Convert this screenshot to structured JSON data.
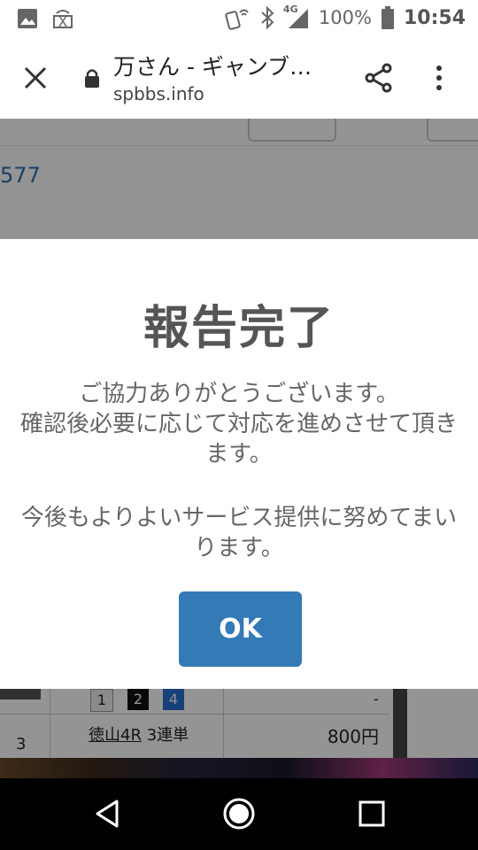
{
  "status_bar": {
    "network": "4G",
    "battery": "100%",
    "time": "10:54"
  },
  "browser": {
    "page_title": "万さん - ギャンブ…",
    "domain": "spbbs.info"
  },
  "background_page": {
    "post_number_fragment": "577",
    "table": {
      "row_number": "3",
      "race": "徳山4R",
      "bet_type": "3連単",
      "amount": "800円",
      "picks": [
        "1",
        "2",
        "4"
      ],
      "dash": "-"
    }
  },
  "dialog": {
    "title": "報告完了",
    "message_lines": [
      "ご協力ありがとうございます。",
      "確認後必要に応じて対応を進めさせて頂き",
      "ます。",
      "今後もよりよいサービス提供に努めてまい",
      "ります。"
    ],
    "ok_label": "OK",
    "button_color": "#337ab7"
  }
}
